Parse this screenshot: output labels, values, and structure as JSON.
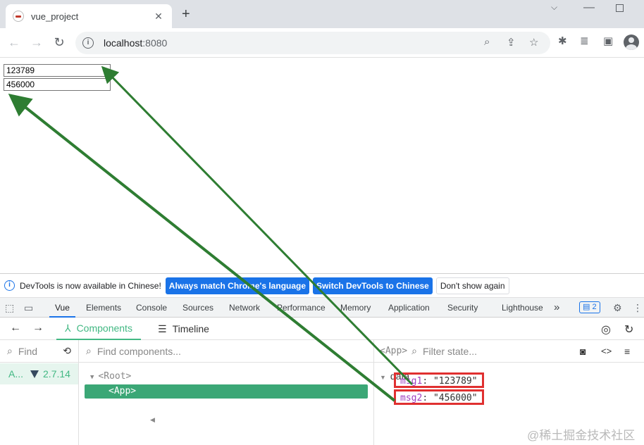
{
  "browser": {
    "tab_title": "vue_project",
    "tab_close": "✕",
    "new_tab": "+",
    "url_host": "localhost",
    "url_port": ":8080"
  },
  "page": {
    "input1_value": "123789",
    "input2_value": "456000"
  },
  "devtools": {
    "infobar_text": "DevTools is now available in Chinese!",
    "btn_match": "Always match Chrome's language",
    "btn_switch": "Switch DevTools to Chinese",
    "btn_dismiss": "Don't show again",
    "tabs": [
      "Vue",
      "Elements",
      "Console",
      "Sources",
      "Network",
      "Performance",
      "Memory",
      "Application",
      "Security",
      "Lighthouse"
    ],
    "more_tabs": "»",
    "issues_count": "2"
  },
  "vue": {
    "components_tab": "Components",
    "timeline_tab": "Timeline",
    "find_placeholder": "Find",
    "app_label": "A...",
    "vue_version": "2.7.14",
    "find_components_placeholder": "Find components...",
    "root_node": "<Root>",
    "app_node": "<App>",
    "state_component": "<App>",
    "filter_placeholder": "Filter state...",
    "data_section": "data",
    "props": [
      {
        "key": "msg1",
        "sep": ": ",
        "value": "\"123789\""
      },
      {
        "key": "msg2",
        "sep": ": ",
        "value": "\"456000\""
      }
    ]
  },
  "watermark": "@稀土掘金技术社区",
  "annotation_color": "#2e7d32",
  "highlight_color": "#e03030"
}
